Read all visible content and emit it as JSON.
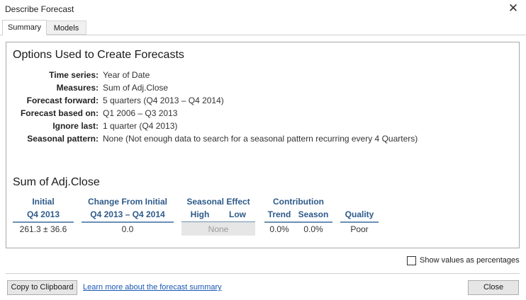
{
  "window": {
    "title": "Describe Forecast",
    "close_glyph": "✕"
  },
  "tabs": [
    {
      "label": "Summary",
      "active": true
    },
    {
      "label": "Models",
      "active": false
    }
  ],
  "options": {
    "heading": "Options Used to Create Forecasts",
    "rows": [
      {
        "label": "Time series:",
        "value": "Year of Date"
      },
      {
        "label": "Measures:",
        "value": "Sum of Adj.Close"
      },
      {
        "label": "Forecast forward:",
        "value": "5 quarters (Q4 2013 – Q4 2014)"
      },
      {
        "label": "Forecast based on:",
        "value": "Q1 2006 – Q3 2013"
      },
      {
        "label": "Ignore last:",
        "value": "1 quarter (Q4 2013)"
      },
      {
        "label": "Seasonal pattern:",
        "value": "None (Not enough data to search for a seasonal pattern recurring every 4 Quarters)"
      }
    ]
  },
  "summary": {
    "heading": "Sum of Adj.Close",
    "headers": {
      "initial": "Initial",
      "initial_period": "Q4 2013",
      "change": "Change From Initial",
      "change_period": "Q4 2013 – Q4 2014",
      "seasonal": "Seasonal Effect",
      "seasonal_high": "High",
      "seasonal_low": "Low",
      "contribution": "Contribution",
      "trend": "Trend",
      "season": "Season",
      "quality": "Quality"
    },
    "values": {
      "initial": "261.3 ±  36.6",
      "change": "0.0",
      "seasonal": "None",
      "trend": "0.0%",
      "season": "0.0%",
      "quality": "Poor"
    }
  },
  "show_percentages": {
    "label": "Show values as percentages",
    "checked": false
  },
  "buttons": {
    "copy": "Copy to Clipboard",
    "learn_more": "Learn more about the forecast summary",
    "close": "Close"
  }
}
